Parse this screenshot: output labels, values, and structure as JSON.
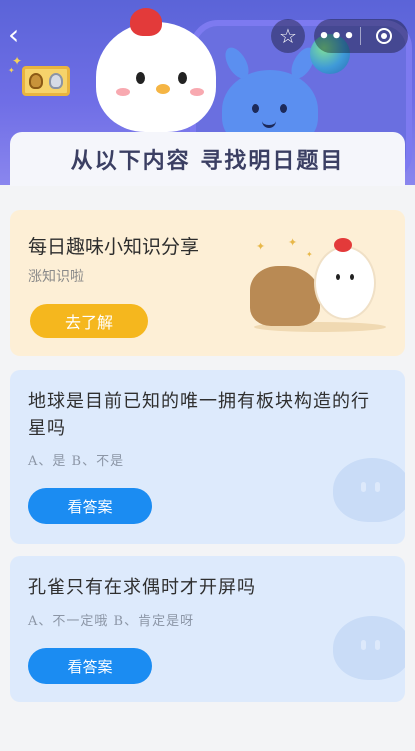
{
  "nav": {
    "back_icon": "back-arrow-icon",
    "star_icon": "star-icon",
    "more_label": "•••",
    "mini_program_icon": "target-icon"
  },
  "banner": {
    "title": "从以下内容  寻找明日题目"
  },
  "share_card": {
    "title": "每日趣味小知识分享",
    "subtitle": "涨知识啦",
    "button": "去了解"
  },
  "questions": [
    {
      "text": "地球是目前已知的唯一拥有板块构造的行星吗",
      "options": "A、是    B、不是",
      "button": "看答案"
    },
    {
      "text": "孔雀只有在求偶时才开屏吗",
      "options": "A、不一定哦    B、肯定是呀",
      "button": "看答案"
    }
  ],
  "colors": {
    "header_purple": "#6f6ee6",
    "share_bg": "#fdefd6",
    "share_button": "#f5b71e",
    "question_bg": "#ddeafc",
    "answer_button": "#1b8cf2"
  }
}
